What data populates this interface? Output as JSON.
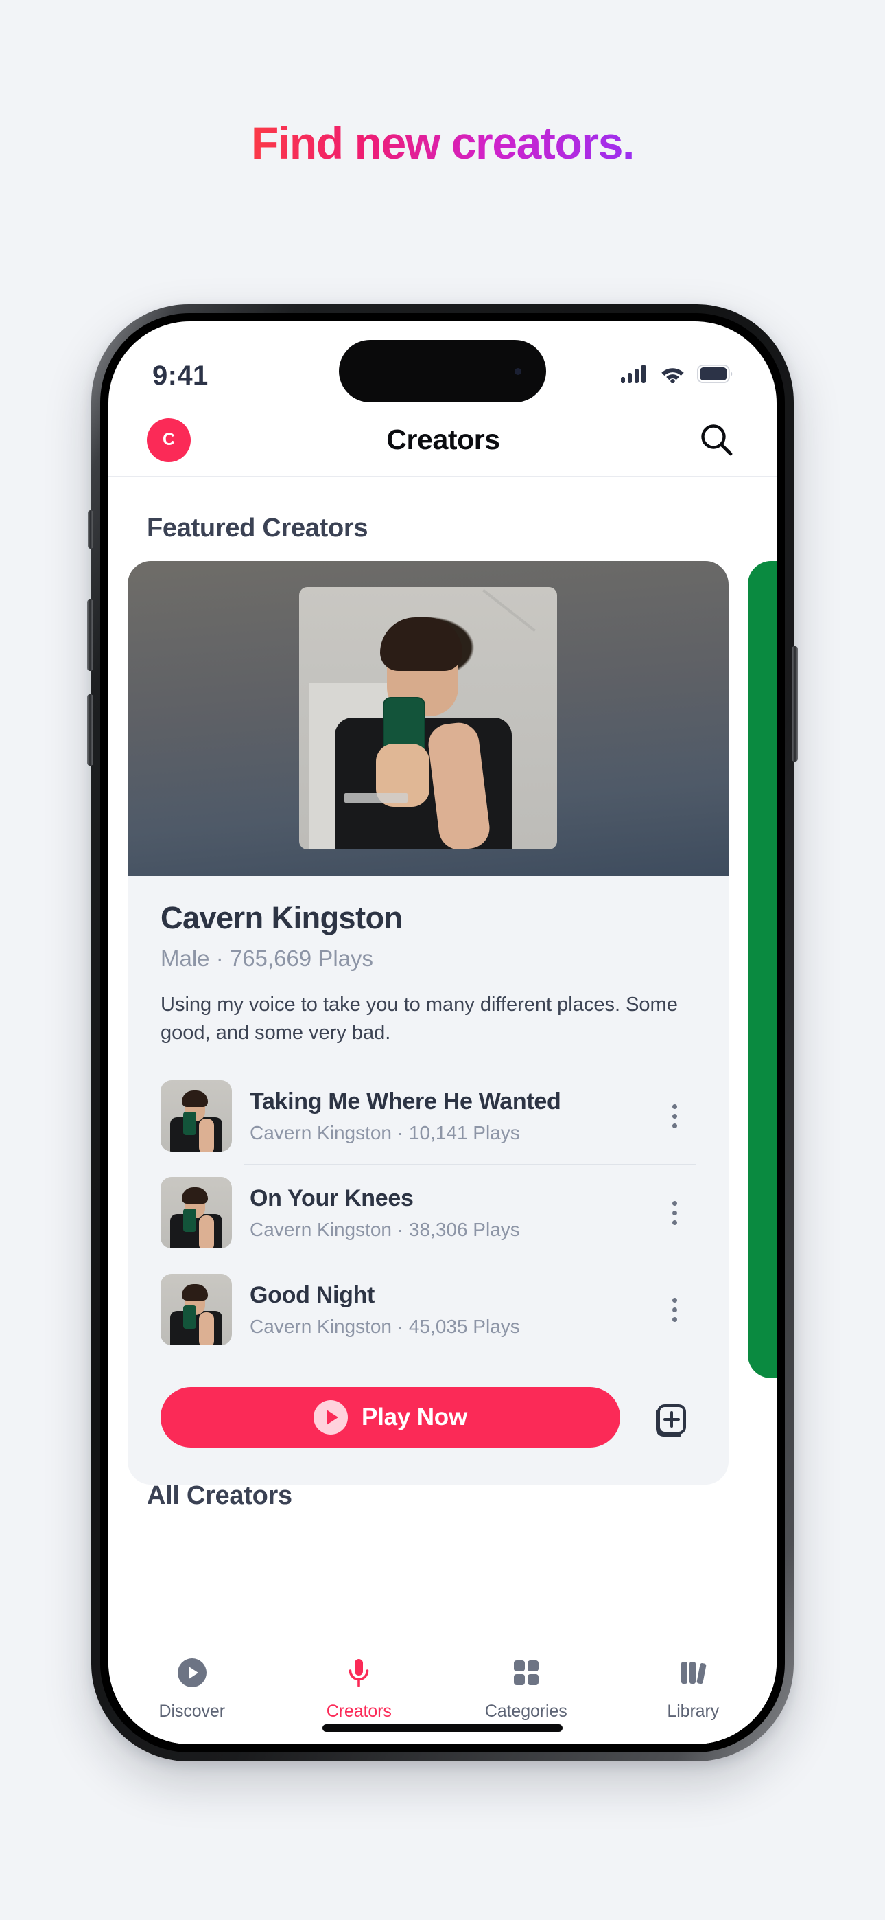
{
  "headline": "Find new creators.",
  "brand": {
    "accent": "#fb2a57",
    "gradient_start": "#fb3b46",
    "gradient_end": "#9b30f0",
    "peek_card_color": "#0a8a40"
  },
  "status_bar": {
    "time": "9:41",
    "signal_icon": "cellular-signal-icon",
    "wifi_icon": "wifi-icon",
    "battery_icon": "battery-icon"
  },
  "navbar": {
    "avatar_initial": "C",
    "title": "Creators",
    "search_icon": "search-icon"
  },
  "sections": {
    "featured_title": "Featured Creators",
    "all_title": "All Creators"
  },
  "creator": {
    "name": "Cavern Kingston",
    "meta": "Male · 765,669 Plays",
    "bio": "Using my voice to take you to many different places. Some good, and some very bad.",
    "tracks": [
      {
        "title": "Taking Me Where He Wanted",
        "subtitle": "Cavern Kingston · 10,141 Plays",
        "menu_icon": "kebab-menu-icon"
      },
      {
        "title": "On Your Knees",
        "subtitle": "Cavern Kingston · 38,306 Plays",
        "menu_icon": "kebab-menu-icon"
      },
      {
        "title": "Good Night",
        "subtitle": "Cavern Kingston · 45,035 Plays",
        "menu_icon": "kebab-menu-icon"
      }
    ],
    "play_label": "Play Now",
    "play_icon": "play-circle-icon",
    "add_icon": "add-to-playlist-icon"
  },
  "tabbar": {
    "items": [
      {
        "label": "Discover",
        "icon": "play-circle-icon",
        "active": false
      },
      {
        "label": "Creators",
        "icon": "microphone-icon",
        "active": true
      },
      {
        "label": "Categories",
        "icon": "grid-squares-icon",
        "active": false
      },
      {
        "label": "Library",
        "icon": "books-icon",
        "active": false
      }
    ]
  }
}
